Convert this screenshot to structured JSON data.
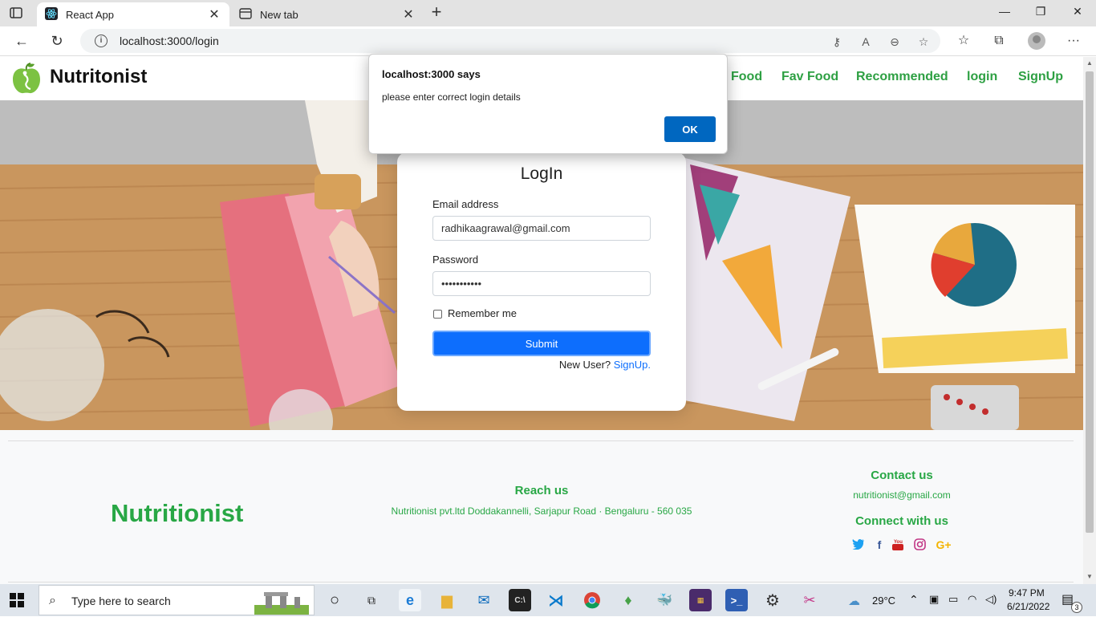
{
  "browser": {
    "tabs": [
      {
        "title": "React App",
        "active": true
      },
      {
        "title": "New tab",
        "active": false
      }
    ],
    "url": "localhost:3000/login"
  },
  "navbar": {
    "brand": "Nutritonist",
    "links": [
      "Food",
      "Fav Food",
      "Recommended",
      "login",
      "SignUp"
    ]
  },
  "login": {
    "title": "LogIn",
    "email_label": "Email address",
    "email_value": "radhikaagrawal@gmail.com",
    "password_label": "Password",
    "password_value": "•••••••••••",
    "remember_label": "Remember me",
    "submit_label": "Submit",
    "new_user_text": "New User?",
    "signup_link": "SignUp."
  },
  "footer": {
    "brand": "Nutritionist",
    "reach_heading": "Reach us",
    "reach_address": "Nutritionist pvt.ltd Doddakannelli, Sarjapur Road · Bengaluru - 560 035",
    "contact_heading": "Contact us",
    "contact_email": "nutritionist@gmail.com",
    "connect_heading": "Connect with us",
    "social_icons": [
      "twitter-icon",
      "facebook-icon",
      "youtube-icon",
      "instagram-icon",
      "google-plus-icon"
    ]
  },
  "dialog": {
    "title": "localhost:3000 says",
    "message": "please enter correct login details",
    "ok_label": "OK"
  },
  "taskbar": {
    "search_placeholder": "Type here to search",
    "weather": "29°C",
    "time": "9:47 PM",
    "date": "6/21/2022",
    "notifications": "3"
  },
  "colors": {
    "accent_green": "#2ea043",
    "primary_blue": "#0d6efd",
    "dialog_blue": "#0067c0"
  }
}
